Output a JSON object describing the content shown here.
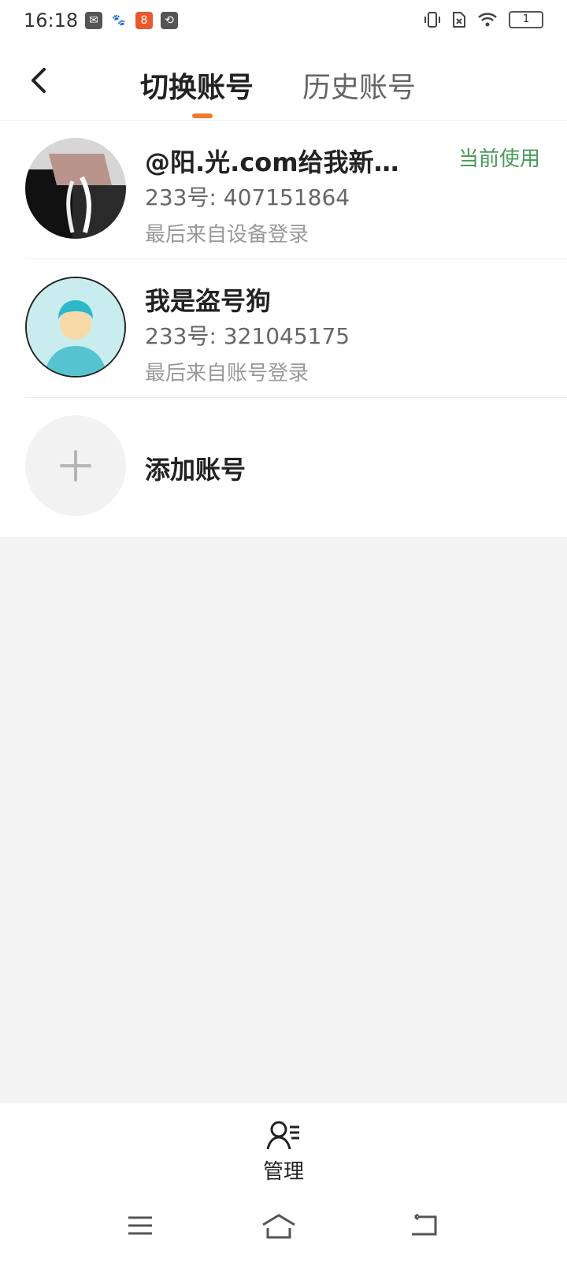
{
  "status_bar": {
    "time": "16:18",
    "left_icons": [
      "mail-icon",
      "baidu-icon",
      "app-icon",
      "sync-icon"
    ],
    "right_icons": [
      "vibrate-icon",
      "no-sim-icon",
      "wifi-icon",
      "battery-icon"
    ],
    "battery_level_text": "1"
  },
  "header": {
    "tab_active": "切换账号",
    "tab_inactive": "历史账号",
    "accent_color": "#ee7a2b"
  },
  "accounts": [
    {
      "name": "@阳.光.com给我新…",
      "id_line": "233号: 407151864",
      "last_login": "最后来自设备登录",
      "badge": "当前使用"
    },
    {
      "name": "我是盗号狗",
      "id_line": "233号: 321045175",
      "last_login": "最后来自账号登录",
      "badge": ""
    }
  ],
  "add_account": {
    "label": "添加账号"
  },
  "bottom": {
    "manage_label": "管理",
    "nav": [
      "menu-icon",
      "home-icon",
      "back-icon"
    ]
  },
  "colors": {
    "current_badge": "#4a9b5a",
    "page_bg": "#f4f4f4"
  }
}
